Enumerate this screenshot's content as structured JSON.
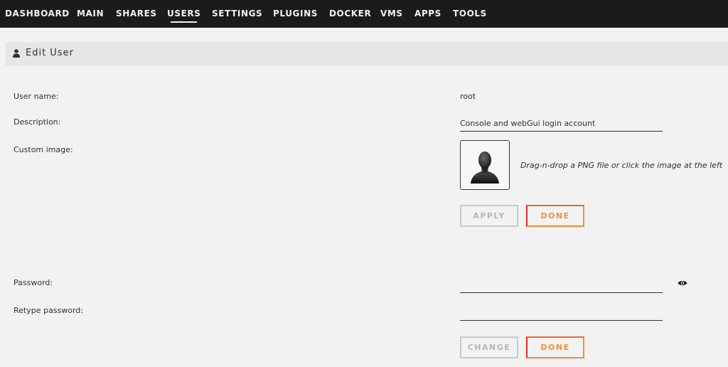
{
  "nav": {
    "items": [
      {
        "label": "DASHBOARD"
      },
      {
        "label": "MAIN"
      },
      {
        "label": "SHARES"
      },
      {
        "label": "USERS"
      },
      {
        "label": "SETTINGS"
      },
      {
        "label": "PLUGINS"
      },
      {
        "label": "DOCKER"
      },
      {
        "label": "VMS"
      },
      {
        "label": "APPS"
      },
      {
        "label": "TOOLS"
      }
    ],
    "active": "USERS"
  },
  "section": {
    "title": "Edit User",
    "icon": "user-icon"
  },
  "form": {
    "username_label": "User name:",
    "username_value": "root",
    "description_label": "Description:",
    "description_value": "Console and webGui login account",
    "custom_image_label": "Custom image:",
    "custom_image_icon": "user-silhouette-icon",
    "drop_hint": "Drag-n-drop a PNG file or click the image at the left",
    "apply_label": "APPLY",
    "done_label": "DONE",
    "password_label": "Password:",
    "password_value": "",
    "retype_label": "Retype password:",
    "retype_value": "",
    "change_label": "CHANGE",
    "done2_label": "DONE",
    "show_password_icon": "eye-icon"
  },
  "colors": {
    "nav_bg": "#1c1b1b",
    "accent_red": "#e22828",
    "accent_orange": "#ff8c2f",
    "disabled": "#b6b6b6"
  }
}
